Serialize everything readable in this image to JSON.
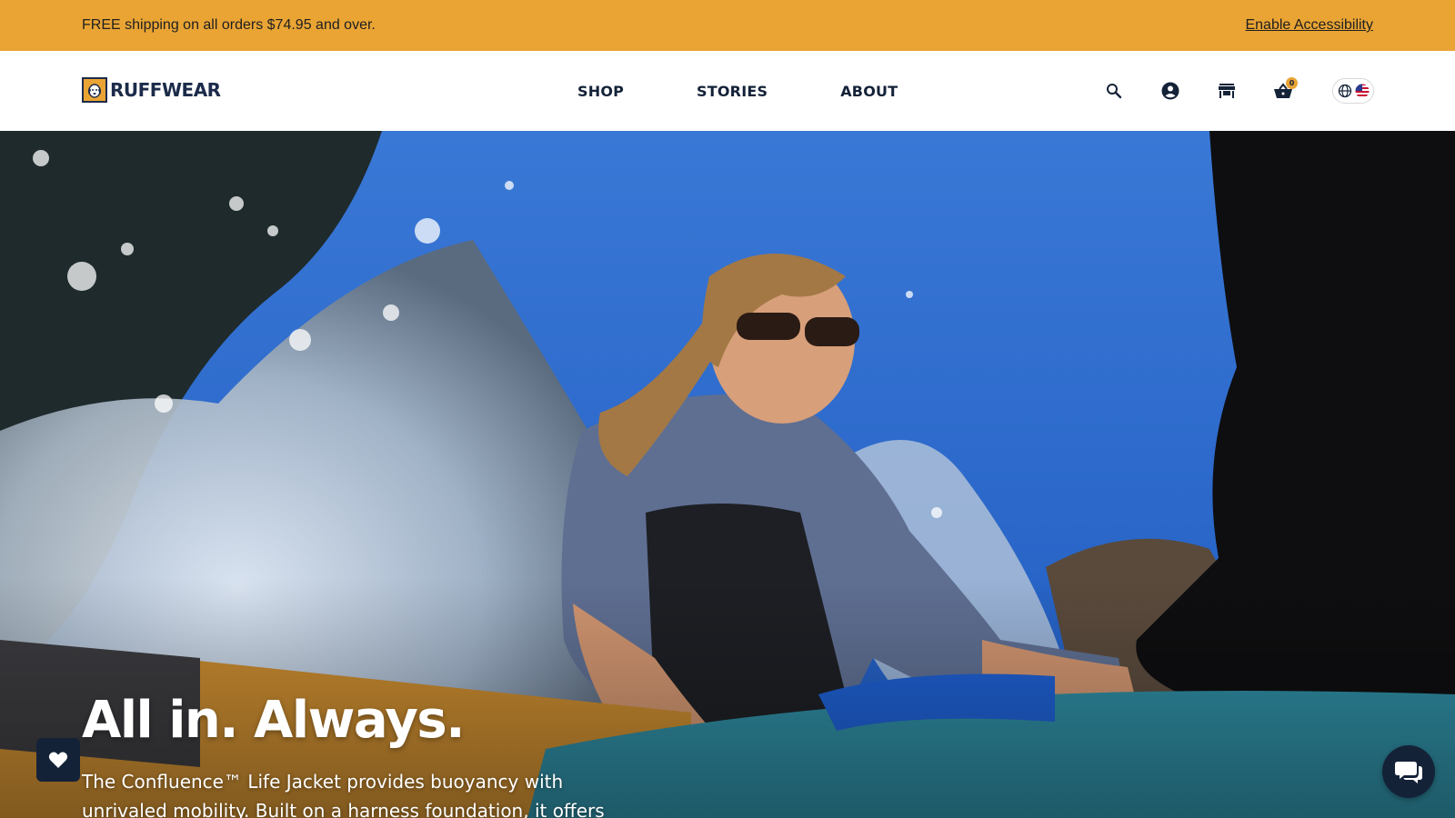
{
  "promo": {
    "shipping_text": "FREE shipping on all orders $74.95 and over.",
    "accessibility_link": "Enable Accessibility"
  },
  "header": {
    "logo_text": "RUFFWEAR",
    "nav": [
      {
        "label": "SHOP"
      },
      {
        "label": "STORIES"
      },
      {
        "label": "ABOUT"
      }
    ],
    "icons": [
      "search-icon",
      "account-icon",
      "store-icon",
      "cart-icon",
      "globe-icon",
      "us-flag-icon"
    ],
    "cart_count": "0"
  },
  "hero": {
    "headline": "All in. Always.",
    "body": "The Confluence™ Life Jacket provides buoyancy with unrivaled mobility. Built on a harness foundation, it offers"
  },
  "floating": {
    "wishlist_icon": "heart-icon",
    "chat_icon": "chat-icon"
  },
  "colors": {
    "promo_bg": "#e9a434",
    "navy": "#142238",
    "badge": "#e9a434"
  }
}
